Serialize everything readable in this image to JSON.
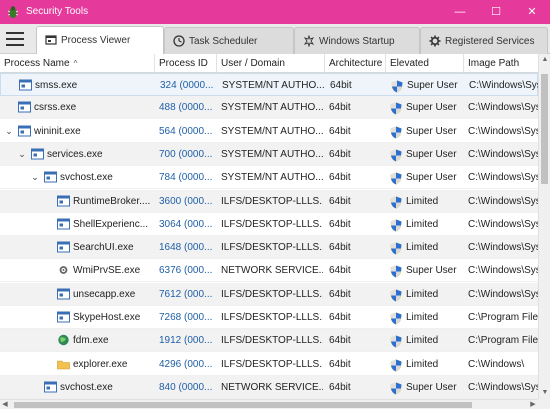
{
  "window": {
    "title": "Security Tools",
    "accent_color": "#e5399b",
    "app_icon": "bug-icon",
    "controls": {
      "minimize": "—",
      "maximize": "☐",
      "close": "✕"
    }
  },
  "tabs": [
    {
      "label": "Process Viewer",
      "icon": "process-icon",
      "active": true
    },
    {
      "label": "Task Scheduler",
      "icon": "clock-icon",
      "active": false
    },
    {
      "label": "Windows Startup",
      "icon": "startup-icon",
      "active": false
    },
    {
      "label": "Registered Services",
      "icon": "gear-icon",
      "active": false
    }
  ],
  "columns": {
    "name": "Process Name",
    "pid": "Process ID",
    "user": "User / Domain",
    "arch": "Architecture",
    "elevated": "Elevated",
    "image": "Image Path",
    "sort_indicator": "^"
  },
  "rows": [
    {
      "level": 0,
      "expander": "",
      "icon": "window-icon",
      "name": "smss.exe",
      "pid": "324 (0000...",
      "user": "SYSTEM/NT AUTHO...",
      "arch": "64bit",
      "elevated": "Super User",
      "image": "C:\\Windows\\Sys"
    },
    {
      "level": 0,
      "expander": "",
      "icon": "window-icon",
      "name": "csrss.exe",
      "pid": "488 (0000...",
      "user": "SYSTEM/NT AUTHO...",
      "arch": "64bit",
      "elevated": "Super User",
      "image": "C:\\Windows\\Sys"
    },
    {
      "level": 0,
      "expander": "⌄",
      "icon": "window-icon",
      "name": "wininit.exe",
      "pid": "564 (0000...",
      "user": "SYSTEM/NT AUTHO...",
      "arch": "64bit",
      "elevated": "Super User",
      "image": "C:\\Windows\\Sys"
    },
    {
      "level": 1,
      "expander": "⌄",
      "icon": "window-icon",
      "name": "services.exe",
      "pid": "700 (0000...",
      "user": "SYSTEM/NT AUTHO...",
      "arch": "64bit",
      "elevated": "Super User",
      "image": "C:\\Windows\\Sys"
    },
    {
      "level": 2,
      "expander": "⌄",
      "icon": "window-icon",
      "name": "svchost.exe",
      "pid": "784 (0000...",
      "user": "SYSTEM/NT AUTHO...",
      "arch": "64bit",
      "elevated": "Super User",
      "image": "C:\\Windows\\Sys"
    },
    {
      "level": 3,
      "expander": "",
      "icon": "window-icon",
      "name": "RuntimeBroker....",
      "pid": "3600 (000...",
      "user": "ILFS/DESKTOP-LLLS...",
      "arch": "64bit",
      "elevated": "Limited",
      "image": "C:\\Windows\\Sys"
    },
    {
      "level": 3,
      "expander": "",
      "icon": "window-icon",
      "name": "ShellExperienc...",
      "pid": "3064 (000...",
      "user": "ILFS/DESKTOP-LLLS...",
      "arch": "64bit",
      "elevated": "Limited",
      "image": "C:\\Windows\\Sys"
    },
    {
      "level": 3,
      "expander": "",
      "icon": "window-icon",
      "name": "SearchUI.exe",
      "pid": "1648 (000...",
      "user": "ILFS/DESKTOP-LLLS...",
      "arch": "64bit",
      "elevated": "Limited",
      "image": "C:\\Windows\\Sys"
    },
    {
      "level": 3,
      "expander": "",
      "icon": "gear-icon",
      "name": "WmiPrvSE.exe",
      "pid": "6376 (000...",
      "user": "NETWORK SERVICE...",
      "arch": "64bit",
      "elevated": "Super User",
      "image": "C:\\Windows\\Sys"
    },
    {
      "level": 3,
      "expander": "",
      "icon": "window-icon",
      "name": "unsecapp.exe",
      "pid": "7612 (000...",
      "user": "ILFS/DESKTOP-LLLS...",
      "arch": "64bit",
      "elevated": "Limited",
      "image": "C:\\Windows\\Sys"
    },
    {
      "level": 3,
      "expander": "",
      "icon": "window-icon",
      "name": "SkypeHost.exe",
      "pid": "7268 (000...",
      "user": "ILFS/DESKTOP-LLLS...",
      "arch": "64bit",
      "elevated": "Limited",
      "image": "C:\\Program File"
    },
    {
      "level": 3,
      "expander": "",
      "icon": "globe-icon",
      "name": "fdm.exe",
      "pid": "1912 (000...",
      "user": "ILFS/DESKTOP-LLLS...",
      "arch": "64bit",
      "elevated": "Limited",
      "image": "C:\\Program File"
    },
    {
      "level": 3,
      "expander": "",
      "icon": "folder-icon",
      "name": "explorer.exe",
      "pid": "4296 (000...",
      "user": "ILFS/DESKTOP-LLLS...",
      "arch": "64bit",
      "elevated": "Limited",
      "image": "C:\\Windows\\"
    },
    {
      "level": 2,
      "expander": "",
      "icon": "window-icon",
      "name": "svchost.exe",
      "pid": "840 (0000...",
      "user": "NETWORK SERVICE...",
      "arch": "64bit",
      "elevated": "Super User",
      "image": "C:\\Windows\\Sys"
    }
  ]
}
